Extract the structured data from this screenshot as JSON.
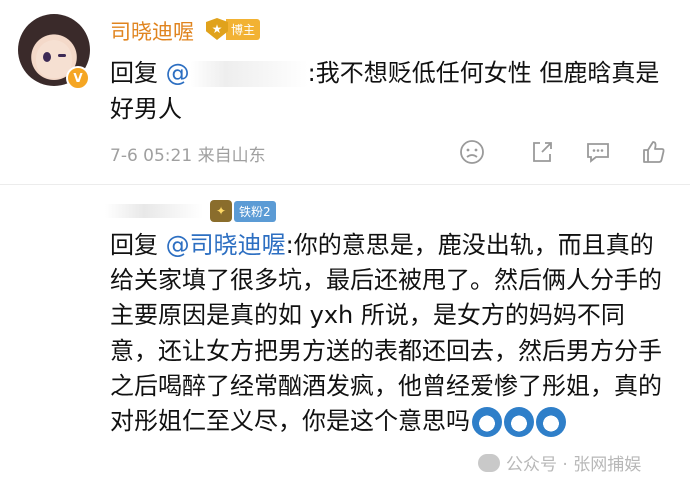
{
  "comment1": {
    "username": "司晓迪喔",
    "badge": "博主",
    "reply_prefix": "回复",
    "mention": "@",
    "text": ":我不想贬低任何女性 但鹿晗真是好男人",
    "time": "7-6 05:21",
    "location": "来自山东"
  },
  "comment2": {
    "fan_badge": "铁粉2",
    "reply_prefix": "回复",
    "mention": "@司晓迪喔",
    "text": ":你的意思是，鹿没出轨，而且真的给关家填了很多坑，最后还被甩了。然后俩人分手的主要原因是真的如 yxh 所说，是女方的妈妈不同意，还让女方把男方送的表都还回去，然后男方分手之后喝醉了经常酗酒发疯，他曾经爱惨了彤姐，真的对彤姐仁至义尽，你是这个意思吗"
  },
  "watermark": "公众号 · 张网捕娱",
  "colors": {
    "username": "#e0841f",
    "mention": "#2d6fc2",
    "meta": "#a0a0a0"
  },
  "icons": [
    "dislike-icon",
    "share-icon",
    "comment-icon",
    "like-icon",
    "emoji-icon"
  ]
}
